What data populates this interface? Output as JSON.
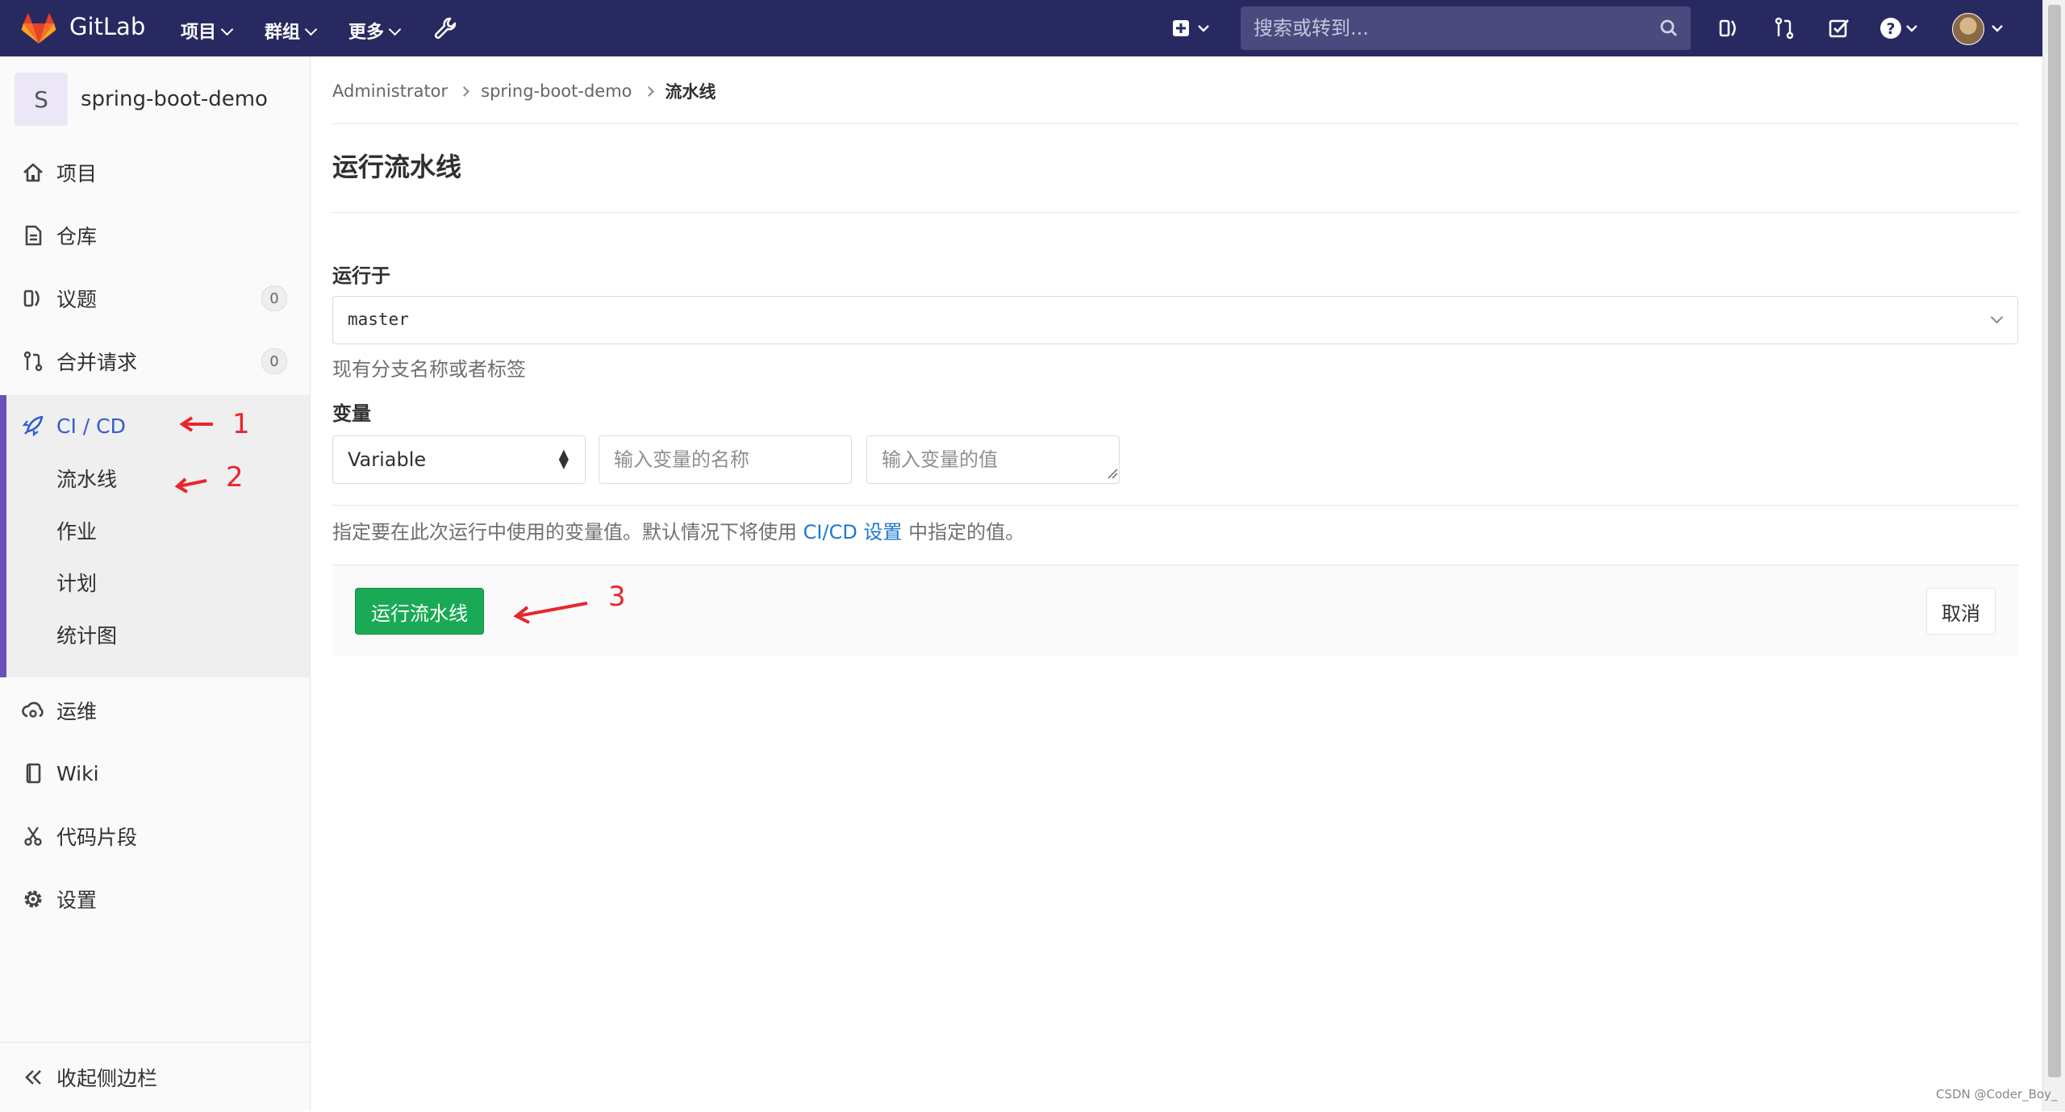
{
  "navbar": {
    "brand": "GitLab",
    "menus": [
      {
        "label": "项目"
      },
      {
        "label": "群组"
      },
      {
        "label": "更多"
      }
    ],
    "search_placeholder": "搜索或转到..."
  },
  "sidebar": {
    "project_initial": "S",
    "project_name": "spring-boot-demo",
    "items": [
      {
        "label": "项目",
        "icon": "home-icon"
      },
      {
        "label": "仓库",
        "icon": "document-icon"
      },
      {
        "label": "议题",
        "icon": "issues-icon",
        "count": "0"
      },
      {
        "label": "合并请求",
        "icon": "merge-request-icon",
        "count": "0"
      },
      {
        "label": "CI / CD",
        "icon": "rocket-icon"
      },
      {
        "label": "运维",
        "icon": "cloud-gear-icon"
      },
      {
        "label": "Wiki",
        "icon": "book-icon"
      },
      {
        "label": "代码片段",
        "icon": "scissors-icon"
      },
      {
        "label": "设置",
        "icon": "settings-icon"
      }
    ],
    "cicd_sub": [
      "流水线",
      "作业",
      "计划",
      "统计图"
    ],
    "collapse_label": "收起侧边栏"
  },
  "breadcrumb": [
    "Administrator",
    "spring-boot-demo",
    "流水线"
  ],
  "page": {
    "title": "运行流水线",
    "run_for_label": "运行于",
    "ref_value": "master",
    "ref_help": "现有分支名称或者标签",
    "variables_label": "变量",
    "var_type": "Variable",
    "var_key_placeholder": "输入变量的名称",
    "var_value_placeholder": "输入变量的值",
    "vars_help_prefix": "指定要在此次运行中使用的变量值。默认情况下将使用 ",
    "vars_help_link": "CI/CD 设置",
    "vars_help_suffix": " 中指定的值。",
    "run_button": "运行流水线",
    "cancel_button": "取消"
  },
  "annotations": [
    "1",
    "2",
    "3"
  ],
  "watermark": "CSDN @Coder_Boy_",
  "colors": {
    "navbar": "#292961",
    "accent": "#6b4fbb",
    "run_button": "#1aaa55",
    "link": "#1f78d1",
    "annotation": "#e8262d"
  }
}
